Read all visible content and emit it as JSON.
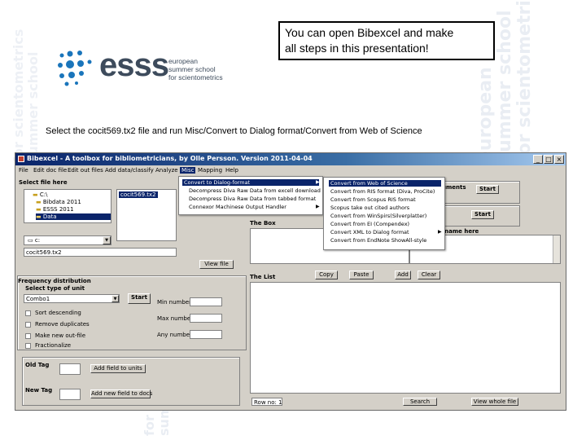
{
  "callout": {
    "line1": "You can open Bibexcel and make",
    "line2": "all steps in this presentation!"
  },
  "logo": {
    "word": "esss",
    "sub1": "european",
    "sub2": "summer school",
    "sub3": "for scientometrics",
    "dot_color": "#1a75bb"
  },
  "watermark": {
    "line1": "european",
    "line2": "summer school",
    "line3": "for scientometrics"
  },
  "instruction": "Select the cocit569.tx2 file and run Misc/Convert to Dialog format/Convert from Web of Science",
  "app": {
    "title": "Bibexcel - A toolbox for bibliometricians, by Olle Persson. Version 2011-04-04",
    "window_buttons": {
      "minimize": "_",
      "maximize": "□",
      "close": "×"
    },
    "menu": [
      "File",
      "Edit doc file",
      "Edit out files",
      "Add data/classify",
      "Analyze",
      "Misc",
      "Mapping",
      "Help"
    ],
    "selected_menu": "Misc",
    "misc_menu": [
      "Convert to Dialog-format",
      "Decompress Diva Raw Data from excell download",
      "Decompress Diva Raw Data from tabbed format",
      "Connexor Machinese Output Handler"
    ],
    "convert_submenu": [
      "Convert from Web of Science",
      "Convert from RIS format (Diva, ProCite)",
      "Convert from Scopus RIS format",
      "Scopus take out cited authors",
      "Convert from WinSpirs(Silverplatter)",
      "Convert from EI (Compendex)",
      "Convert XML to Dialog format",
      "Convert from EndNote ShowAll-style"
    ],
    "select_file_label": "Select file here",
    "folders": [
      "C:\\",
      "Bibdata 2011",
      "ESSS 2011",
      "Data"
    ],
    "file_list_item": "cocit569.tx2",
    "drive": "c:",
    "filename": "cocit569.tx2",
    "view_file": "View file",
    "freq_dist_label": "Frequency distribution",
    "select_unit_label": "Select type of unit",
    "unit_select": "Combo1",
    "start": "Start",
    "min_number": "Min number",
    "max_number": "Max number",
    "any_number": "Any number",
    "options": [
      "Sort descending",
      "Remove duplicates",
      "Make new out-file",
      "Fractionalize"
    ],
    "old_tag": "Old Tag",
    "new_tag": "New Tag",
    "add_field_units": "Add field to units",
    "add_new_field_docs": "Add new field to docs",
    "the_box": "The Box",
    "the_list": "The List",
    "buttons": {
      "copy": "Copy",
      "paste": "Paste",
      "add": "Add",
      "clear": "Clear"
    },
    "row_no": "Row no: 1",
    "search": "Search",
    "view_whole_file": "View whole file",
    "right_documents": "uments",
    "right_s": "s",
    "right_start1": "Start",
    "right_start2": "Start",
    "right_name_here": "e name here"
  }
}
